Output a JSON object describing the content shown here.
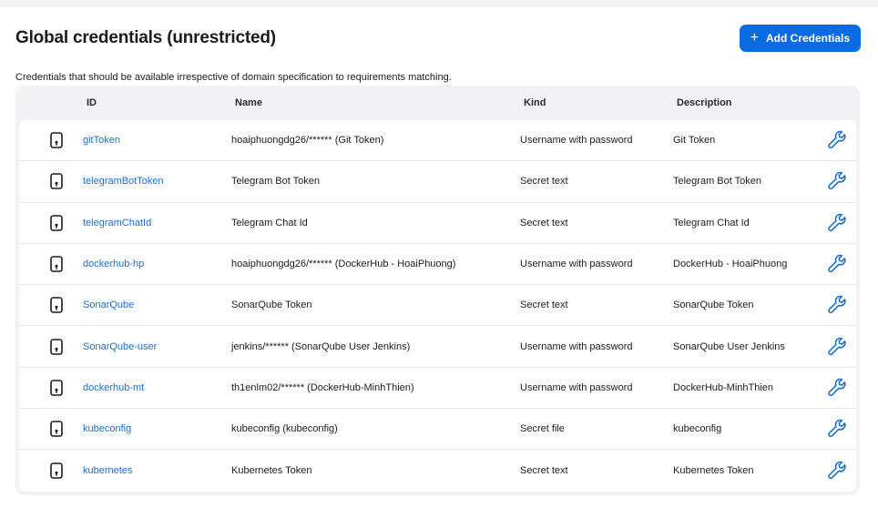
{
  "page": {
    "title": "Global credentials (unrestricted)",
    "subtitle": "Credentials that should be available irrespective of domain specification to requirements matching."
  },
  "actions": {
    "add_label": "Add Credentials",
    "add_icon": "plus-icon"
  },
  "colors": {
    "accent": "#0b6be0",
    "link": "#1a6fd1",
    "table_bg": "#f2f2f5"
  },
  "table": {
    "columns": [
      "",
      "ID",
      "Name",
      "Kind",
      "Description",
      ""
    ],
    "row_icon": "credential-store-icon",
    "action_icon": "wrench-icon",
    "rows": [
      {
        "id": "gitToken",
        "name": "hoaiphuongdg26/****** (Git Token)",
        "kind": "Username with password",
        "description": "Git Token"
      },
      {
        "id": "telegramBotToken",
        "name": "Telegram Bot Token",
        "kind": "Secret text",
        "description": "Telegram Bot Token"
      },
      {
        "id": "telegramChatId",
        "name": "Telegram Chat Id",
        "kind": "Secret text",
        "description": "Telegram Chat Id"
      },
      {
        "id": "dockerhub-hp",
        "name": "hoaiphuongdg26/****** (DockerHub - HoaiPhuong)",
        "kind": "Username with password",
        "description": "DockerHub - HoaiPhuong"
      },
      {
        "id": "SonarQube",
        "name": "SonarQube Token",
        "kind": "Secret text",
        "description": "SonarQube Token"
      },
      {
        "id": "SonarQube-user",
        "name": "jenkins/****** (SonarQube User Jenkins)",
        "kind": "Username with password",
        "description": "SonarQube User Jenkins"
      },
      {
        "id": "dockerhub-mt",
        "name": "th1enlm02/****** (DockerHub-MinhThien)",
        "kind": "Username with password",
        "description": "DockerHub-MinhThien"
      },
      {
        "id": "kubeconfig",
        "name": "kubeconfig (kubeconfig)",
        "kind": "Secret file",
        "description": "kubeconfig"
      },
      {
        "id": "kubernetes",
        "name": "Kubernetes Token",
        "kind": "Secret text",
        "description": "Kubernetes Token"
      }
    ]
  }
}
